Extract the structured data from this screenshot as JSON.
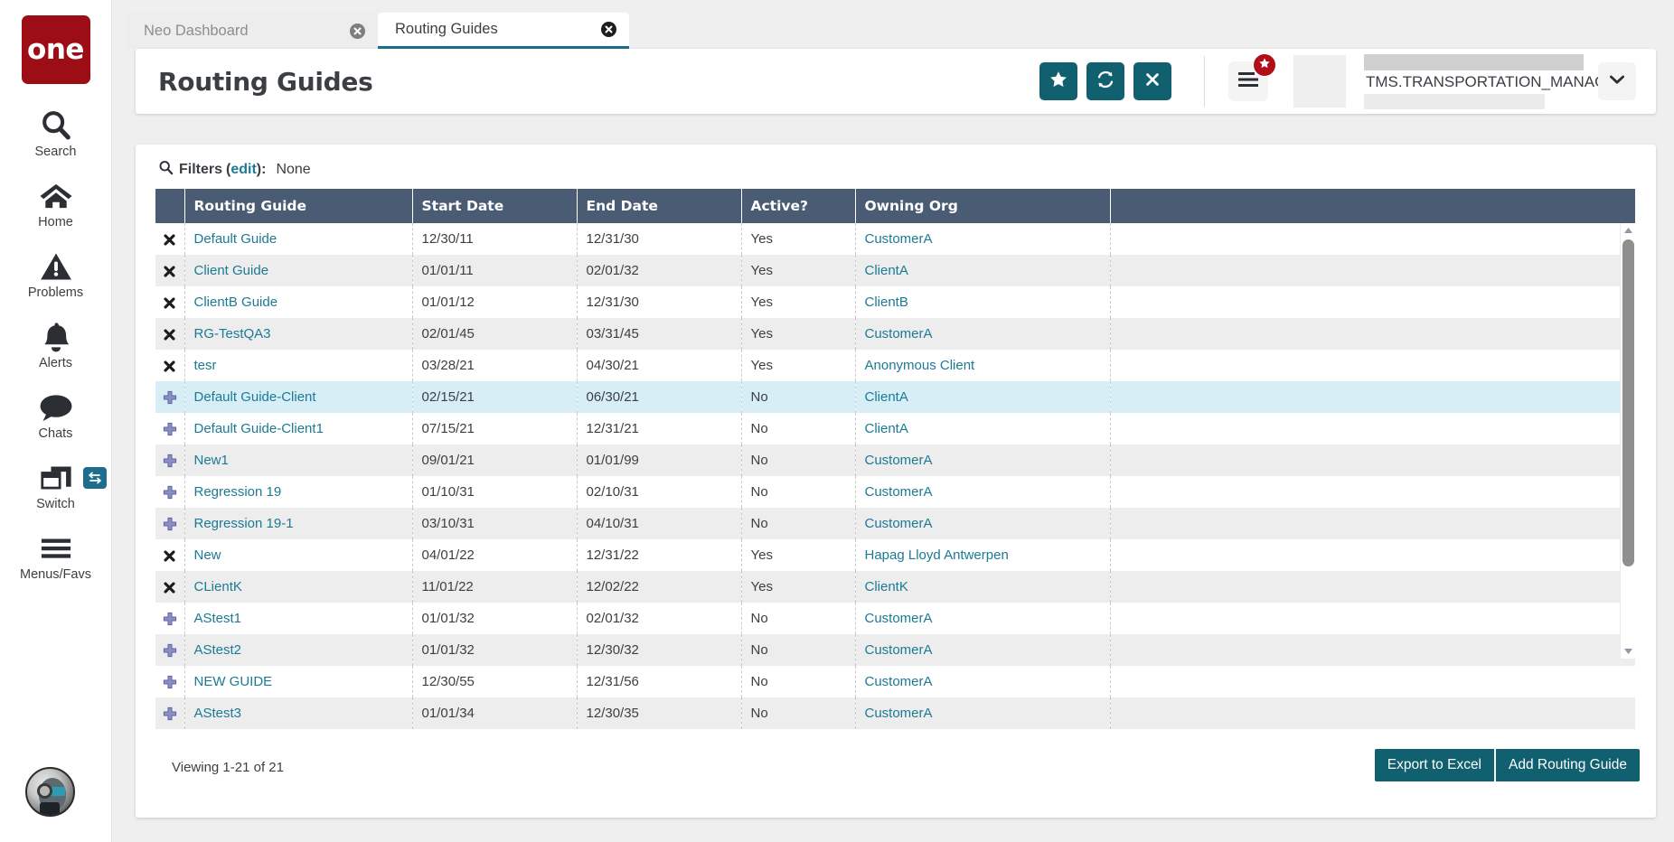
{
  "brand": {
    "logo_text": "one"
  },
  "sidebar": {
    "items": [
      {
        "label": "Search",
        "icon": "search-icon"
      },
      {
        "label": "Home",
        "icon": "home-icon"
      },
      {
        "label": "Problems",
        "icon": "warning-triangle-icon"
      },
      {
        "label": "Alerts",
        "icon": "bell-icon"
      },
      {
        "label": "Chats",
        "icon": "chat-bubble-icon"
      },
      {
        "label": "Switch",
        "icon": "windows-stack-icon",
        "badge_icon": "swap-arrows-icon"
      },
      {
        "label": "Menus/Favs",
        "icon": "hamburger-icon"
      }
    ],
    "avatar": "user-avatar"
  },
  "tabs": [
    {
      "label": "Neo Dashboard",
      "active": false,
      "close_icon": "close-circle-icon"
    },
    {
      "label": "Routing Guides",
      "active": true,
      "close_icon": "close-circle-icon"
    }
  ],
  "header": {
    "title": "Routing Guides",
    "actions": [
      {
        "name": "favorite-button",
        "icon": "star-icon"
      },
      {
        "name": "refresh-button",
        "icon": "refresh-icon"
      },
      {
        "name": "close-button",
        "icon": "x-icon"
      }
    ],
    "menu_button": {
      "icon": "menu-lines-icon",
      "badge_icon": "star-icon"
    },
    "user": {
      "name": "TMS.TRANSPORTATION_MANAGER",
      "caret_icon": "chevron-down-icon"
    }
  },
  "filters": {
    "icon": "search-icon",
    "label": "Filters",
    "edit_link": "edit",
    "colon": "):",
    "open_paren": "(",
    "value": "None"
  },
  "table": {
    "columns": [
      "",
      "Routing Guide",
      "Start Date",
      "End Date",
      "Active?",
      "Owning Org",
      ""
    ],
    "rows": [
      {
        "action_icon": "x-mark-icon",
        "guide": "Default Guide",
        "start": "12/30/11",
        "end": "12/31/30",
        "active": "Yes",
        "org": "CustomerA"
      },
      {
        "action_icon": "x-mark-icon",
        "guide": "Client Guide",
        "start": "01/01/11",
        "end": "02/01/32",
        "active": "Yes",
        "org": "ClientA"
      },
      {
        "action_icon": "x-mark-icon",
        "guide": "ClientB Guide",
        "start": "01/01/12",
        "end": "12/31/30",
        "active": "Yes",
        "org": "ClientB"
      },
      {
        "action_icon": "x-mark-icon",
        "guide": "RG-TestQA3",
        "start": "02/01/45",
        "end": "03/31/45",
        "active": "Yes",
        "org": "CustomerA"
      },
      {
        "action_icon": "x-mark-icon",
        "guide": "tesr",
        "start": "03/28/21",
        "end": "04/30/21",
        "active": "Yes",
        "org": "Anonymous Client"
      },
      {
        "action_icon": "plus-cross-icon",
        "guide": "Default Guide-Client",
        "start": "02/15/21",
        "end": "06/30/21",
        "active": "No",
        "org": "ClientA",
        "selected": true
      },
      {
        "action_icon": "plus-cross-icon",
        "guide": "Default Guide-Client1",
        "start": "07/15/21",
        "end": "12/31/21",
        "active": "No",
        "org": "ClientA"
      },
      {
        "action_icon": "plus-cross-icon",
        "guide": "New1",
        "start": "09/01/21",
        "end": "01/01/99",
        "active": "No",
        "org": "CustomerA"
      },
      {
        "action_icon": "plus-cross-icon",
        "guide": "Regression 19",
        "start": "01/10/31",
        "end": "02/10/31",
        "active": "No",
        "org": "CustomerA"
      },
      {
        "action_icon": "plus-cross-icon",
        "guide": "Regression 19-1",
        "start": "03/10/31",
        "end": "04/10/31",
        "active": "No",
        "org": "CustomerA"
      },
      {
        "action_icon": "x-mark-icon",
        "guide": "New",
        "start": "04/01/22",
        "end": "12/31/22",
        "active": "Yes",
        "org": "Hapag Lloyd Antwerpen"
      },
      {
        "action_icon": "x-mark-icon",
        "guide": "CLientK",
        "start": "11/01/22",
        "end": "12/02/22",
        "active": "Yes",
        "org": "ClientK"
      },
      {
        "action_icon": "plus-cross-icon",
        "guide": "AStest1",
        "start": "01/01/32",
        "end": "02/01/32",
        "active": "No",
        "org": "CustomerA"
      },
      {
        "action_icon": "plus-cross-icon",
        "guide": "AStest2",
        "start": "01/01/32",
        "end": "12/30/32",
        "active": "No",
        "org": "CustomerA"
      },
      {
        "action_icon": "plus-cross-icon",
        "guide": "NEW GUIDE",
        "start": "12/30/55",
        "end": "12/31/56",
        "active": "No",
        "org": "CustomerA"
      },
      {
        "action_icon": "plus-cross-icon",
        "guide": "AStest3",
        "start": "01/01/34",
        "end": "12/30/35",
        "active": "No",
        "org": "CustomerA"
      }
    ],
    "scrollbar": {
      "up_icon": "triangle-up-icon",
      "down_icon": "triangle-down-icon"
    }
  },
  "footer": {
    "viewing": "Viewing 1-21 of 21",
    "export_button": "Export to Excel",
    "add_button": "Add Routing Guide"
  },
  "colors": {
    "brand_red": "#9c0d16",
    "teal": "#106070",
    "link": "#1c7a94",
    "table_header": "#4a5c74",
    "row_selected": "#d7eef7",
    "row_alt": "#ededed",
    "badge_red": "#b00f17"
  }
}
